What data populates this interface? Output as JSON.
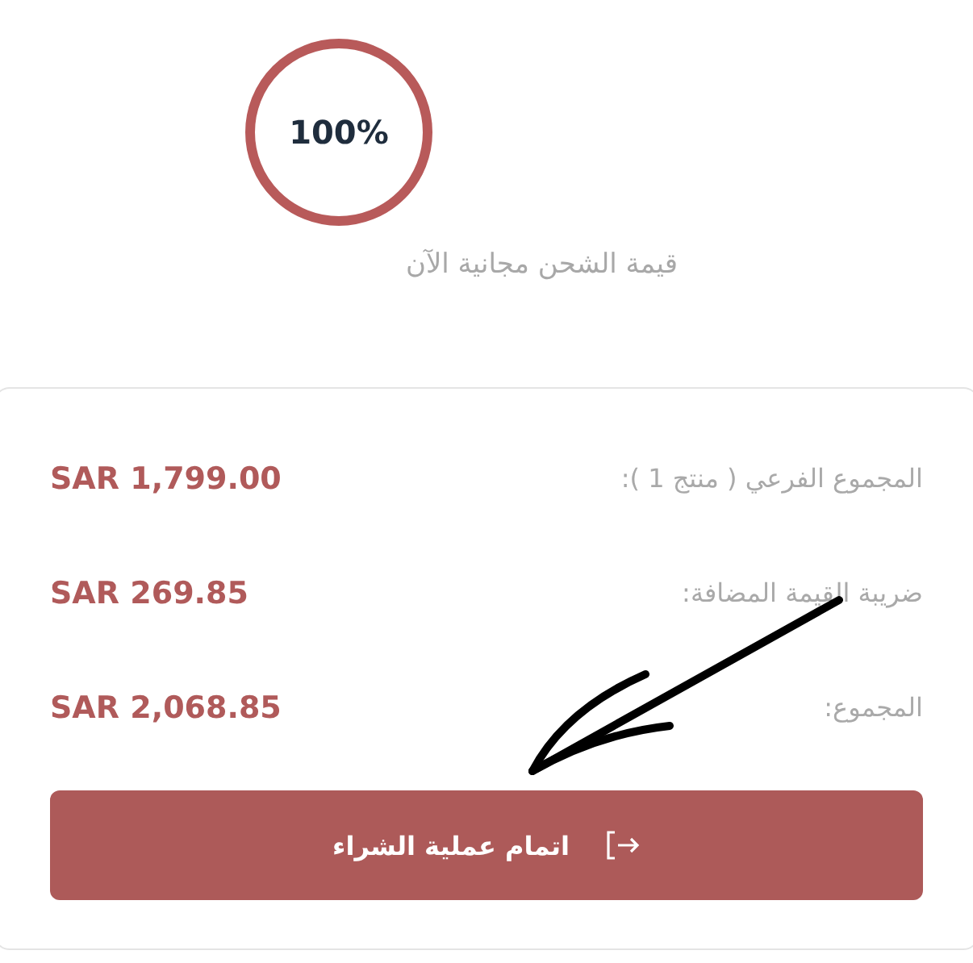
{
  "shipping": {
    "percent": "100%",
    "label": "قيمة الشحن مجانية الآن"
  },
  "summary": {
    "rows": [
      {
        "label": "المجموع الفرعي ( منتج 1 ):",
        "amount": "SAR 1,799.00"
      },
      {
        "label": "ضريبة القيمة المضافة:",
        "amount": "SAR 269.85"
      },
      {
        "label": "المجموع:",
        "amount": "SAR 2,068.85"
      }
    ],
    "checkout_button": "اتمام عملية الشراء"
  },
  "annotation": {
    "kind": "arrow"
  }
}
